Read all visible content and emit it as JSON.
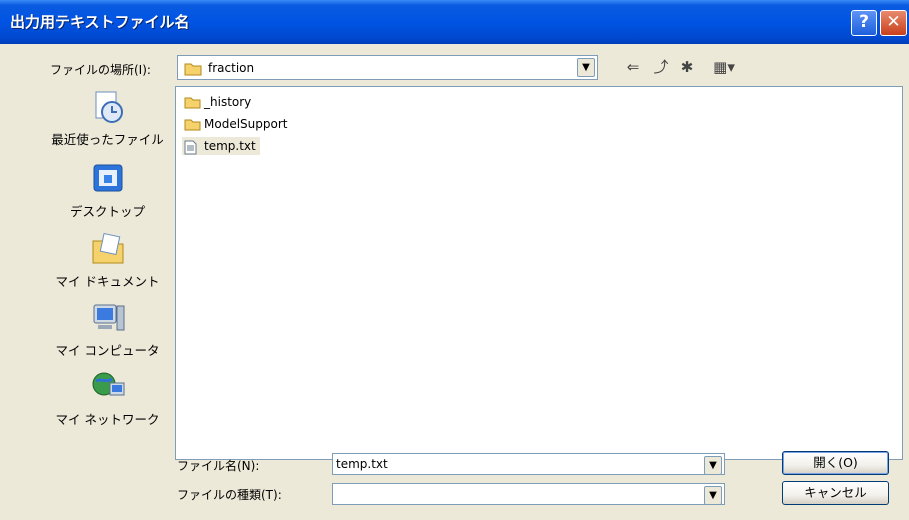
{
  "window": {
    "title": "出力用テキストファイル名",
    "help_glyph": "?",
    "close_glyph": "✕"
  },
  "lookin": {
    "label": "ファイルの場所(I):",
    "value": "fraction"
  },
  "toolbar": {
    "back_glyph": "⇐",
    "up_glyph": "⤴",
    "newfolder_glyph": "✱",
    "views_glyph": "▦▾"
  },
  "places": [
    {
      "label": "最近使ったファイル",
      "icon": "recent-documents-icon"
    },
    {
      "label": "デスクトップ",
      "icon": "desktop-icon"
    },
    {
      "label": "マイ ドキュメント",
      "icon": "my-documents-icon"
    },
    {
      "label": "マイ コンピュータ",
      "icon": "my-computer-icon"
    },
    {
      "label": "マイ ネットワーク",
      "icon": "my-network-icon"
    }
  ],
  "files": [
    {
      "name": "_history",
      "type": "folder"
    },
    {
      "name": "ModelSupport",
      "type": "folder"
    },
    {
      "name": "temp.txt",
      "type": "text-file"
    }
  ],
  "filename": {
    "label": "ファイル名(N):",
    "value": "temp.txt"
  },
  "filetype": {
    "label": "ファイルの種類(T):",
    "value": ""
  },
  "buttons": {
    "open": "開く(O)",
    "cancel": "キャンセル"
  },
  "colors": {
    "titlebar": "#0054e3",
    "dialog_bg": "#ece9d8",
    "border": "#7f9db9"
  }
}
